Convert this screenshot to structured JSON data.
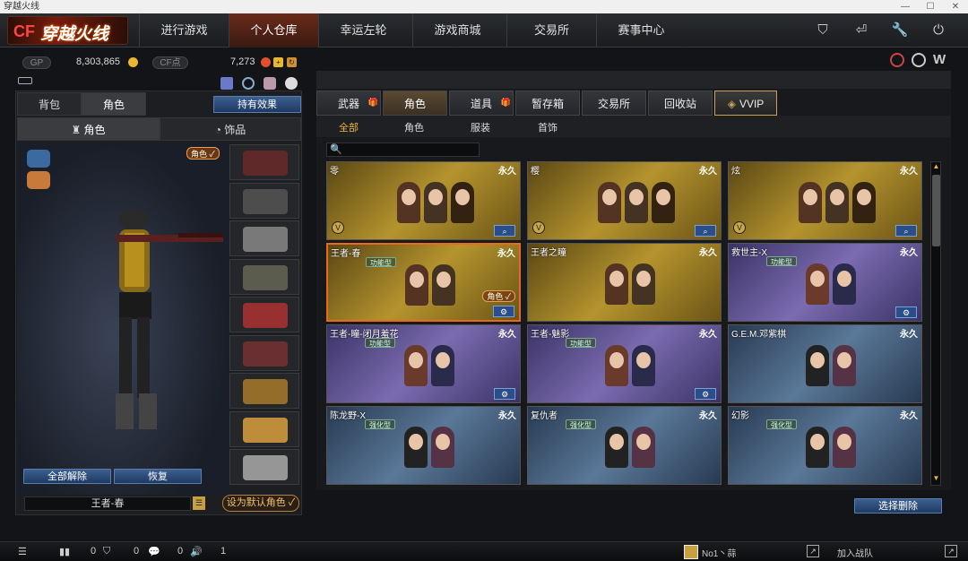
{
  "window": {
    "title": "穿越火线",
    "min": "—",
    "max": "☐",
    "close": "✕"
  },
  "nav": {
    "logo": "穿越火线",
    "tabs": [
      "进行游戏",
      "个人仓库",
      "幸运左轮",
      "游戏商城",
      "交易所",
      "赛事中心"
    ],
    "active_tab": 1,
    "icons": [
      {
        "name": "shield-icon",
        "glyph": "⛉"
      },
      {
        "name": "exit-icon",
        "glyph": "⏎"
      },
      {
        "name": "tools-icon",
        "glyph": "🔧"
      },
      {
        "name": "power-icon",
        "glyph": "⏻"
      }
    ]
  },
  "currency": {
    "gp_label": "GP",
    "gp_value": "8,303,865",
    "cf_label": "CF点",
    "cf_value": "7,273"
  },
  "left": {
    "tabs": [
      "背包",
      "角色"
    ],
    "active_tab": 1,
    "effect_btn": "持有效果",
    "subtabs": [
      "角色",
      "饰品"
    ],
    "role_badge": "角色 ✓",
    "unequip_all": "全部解除",
    "restore": "恢复",
    "char_name": "王者-春",
    "set_default": "设为默认角色 ✓"
  },
  "right": {
    "tabs": [
      {
        "label": "武器",
        "gift": true
      },
      {
        "label": "角色",
        "gift": false
      },
      {
        "label": "道具",
        "gift": true
      },
      {
        "label": "暂存箱",
        "gift": false
      },
      {
        "label": "交易所",
        "gift": false
      },
      {
        "label": "回收站",
        "gift": false
      },
      {
        "label": "VVIP",
        "gift": false
      }
    ],
    "active_tab": 1,
    "filters": [
      "全部",
      "角色",
      "服装",
      "首饰"
    ],
    "active_filter": 0,
    "search_placeholder": "",
    "delete_btn": "选择删除",
    "cards": [
      {
        "name": "零",
        "perm": "永久",
        "tone": "gold",
        "vip": true,
        "tag": "",
        "icon": "search-icon"
      },
      {
        "name": "樱",
        "perm": "永久",
        "tone": "gold",
        "vip": true,
        "tag": "",
        "icon": "search-icon"
      },
      {
        "name": "炫",
        "perm": "永久",
        "tone": "gold",
        "vip": true,
        "tag": "",
        "icon": "search-icon"
      },
      {
        "name": "王者-春",
        "perm": "永久",
        "tone": "gold",
        "vip": false,
        "tag": "功能型",
        "icon": "gear-icon",
        "selected": true,
        "role": "角色 ✓"
      },
      {
        "name": "王者之瞳",
        "perm": "永久",
        "tone": "gold",
        "vip": false,
        "tag": "",
        "icon": ""
      },
      {
        "name": "救世主-X",
        "perm": "永久",
        "tone": "purple",
        "vip": false,
        "tag": "功能型",
        "icon": "gear-icon"
      },
      {
        "name": "王者-瞳-闭月羞花",
        "perm": "永久",
        "tone": "purple",
        "vip": false,
        "tag": "功能型",
        "icon": "gear-icon"
      },
      {
        "name": "王者-魅影",
        "perm": "永久",
        "tone": "purple",
        "vip": false,
        "tag": "功能型",
        "icon": "gear-icon"
      },
      {
        "name": "G.E.M.邓紫棋",
        "perm": "永久",
        "tone": "blue",
        "vip": false,
        "tag": "",
        "icon": ""
      },
      {
        "name": "陈龙野-X",
        "perm": "永久",
        "tone": "blue",
        "vip": false,
        "tag": "强化型",
        "icon": ""
      },
      {
        "name": "复仇者",
        "perm": "永久",
        "tone": "blue",
        "vip": false,
        "tag": "强化型",
        "icon": ""
      },
      {
        "name": "幻影",
        "perm": "永久",
        "tone": "blue",
        "vip": false,
        "tag": "强化型",
        "icon": ""
      }
    ]
  },
  "status": {
    "c1": "0",
    "c2": "0",
    "c3": "0",
    "c4": "1",
    "player": "No1丶蒜",
    "join": "加入战队"
  }
}
